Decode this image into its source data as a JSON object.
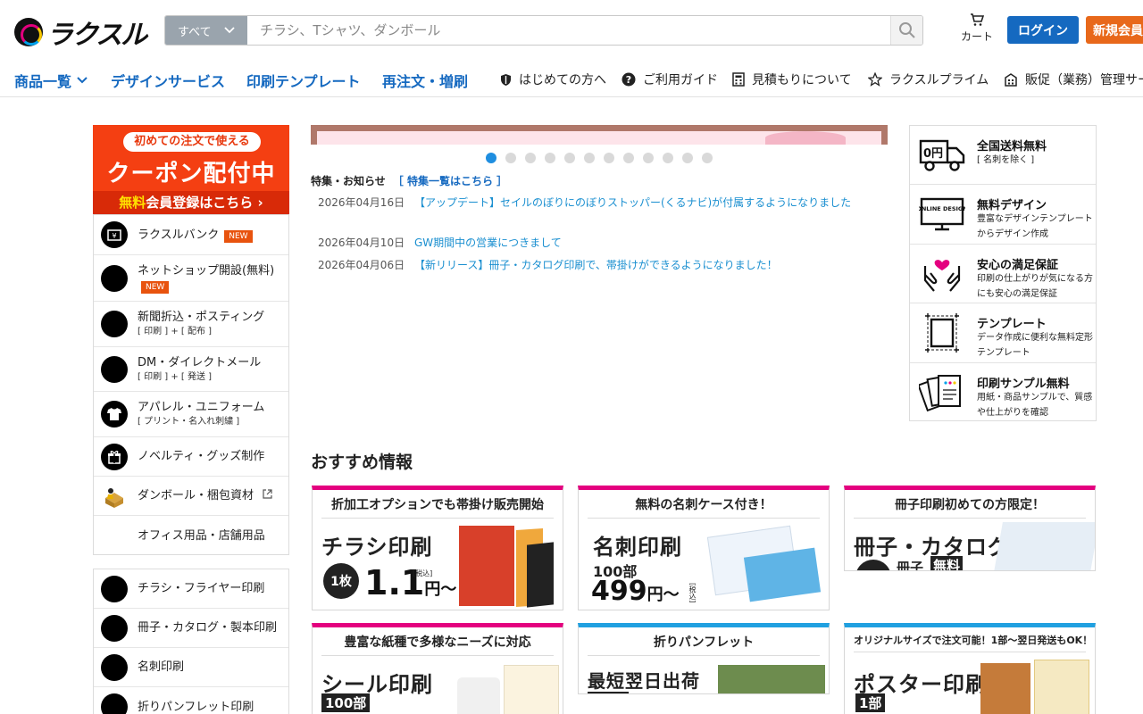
{
  "header": {
    "logo_text": "ラクスル",
    "search_category": "すべて",
    "search_placeholder": "チラシ、Tシャツ、ダンボール",
    "cart_label": "カート",
    "login_label": "ログイン",
    "register_label": "新規会員"
  },
  "nav": {
    "main": [
      "商品一覧",
      "デザインサービス",
      "印刷テンプレート",
      "再注文・増刷"
    ],
    "sub": [
      "はじめての方へ",
      "ご利用ガイド",
      "見積もりについて",
      "ラクスルプライム",
      "販促（業務）管理サー"
    ]
  },
  "coupon": {
    "top": "初めての注文で使える",
    "main": "クーポン配付中",
    "bottom_highlight": "無料",
    "bottom_rest": "会員登録はこちら ›"
  },
  "side_menu_1": [
    {
      "label": "ラクスルバンク",
      "badge": "NEW",
      "sub": ""
    },
    {
      "label": "ネットショップ開設(無料)",
      "badge": "NEW",
      "sub": ""
    },
    {
      "label": "新聞折込・ポスティング",
      "badge": "",
      "sub": "[ 印刷 ] + [ 配布 ]"
    },
    {
      "label": "DM・ダイレクトメール",
      "badge": "",
      "sub": "[ 印刷 ] + [ 発送 ]"
    },
    {
      "label": "アパレル・ユニフォーム",
      "badge": "",
      "sub": "[ プリント・名入れ刺繍 ]"
    },
    {
      "label": "ノベルティ・グッズ制作",
      "badge": "",
      "sub": ""
    },
    {
      "label": "ダンボール・梱包資材",
      "badge": "",
      "sub": ""
    },
    {
      "label": "オフィス用品・店舗用品",
      "badge": "",
      "sub": ""
    }
  ],
  "side_menu_2": [
    {
      "label": "チラシ・フライヤー印刷"
    },
    {
      "label": "冊子・カタログ・製本印刷"
    },
    {
      "label": "名刺印刷"
    },
    {
      "label": "折りパンフレット印刷"
    }
  ],
  "news": {
    "heading": "特集・お知らせ",
    "heading_link": "［ 特集一覧はこちら ］",
    "items": [
      {
        "date": "2026年04月16日",
        "text": "【アップデート】セイルのぼりにのぼりストッパー(くるナビ)が付属するようになりました"
      },
      {
        "date": "2026年04月10日",
        "text": "GW期間中の営業につきまして"
      },
      {
        "date": "2026年04月06日",
        "text": "【新リリース】冊子・カタログ印刷で、帯掛けができるようになりました！"
      }
    ]
  },
  "recommend": {
    "title": "おすすめ情報",
    "cards": [
      {
        "head": "折加工オプションでも帯掛け販売開始",
        "title": "チラシ印刷",
        "qty": "1枚",
        "price": "1.1",
        "unit": "円〜",
        "tax": "[税込]"
      },
      {
        "head": "無料の名刺ケース付き！",
        "title": "名刺印刷",
        "qty": "100部",
        "price": "499",
        "unit": "円〜",
        "tax": "[税込]"
      },
      {
        "head": "冊子印刷初めての方限定！",
        "title": "冊子・カタログ",
        "qty": "冊子",
        "price": "",
        "unit": "",
        "tax": "無料"
      },
      {
        "head": "豊富な紙種で多様なニーズに対応",
        "title": "シール印刷",
        "qty": "100部",
        "price": "",
        "unit": "",
        "tax": ""
      },
      {
        "head": "折りパンフレット",
        "title": "最短翌日出荷",
        "qty": "",
        "price": "",
        "unit": "",
        "tax": ""
      },
      {
        "head": "オリジナルサイズで注文可能！1部〜翌日発送もOK！",
        "title": "ポスター印刷",
        "qty": "1部",
        "price": "",
        "unit": "",
        "tax": ""
      }
    ]
  },
  "features": [
    {
      "title": "全国送料無料",
      "desc": "[ 名刺を除く ]"
    },
    {
      "title": "無料デザイン",
      "desc": "豊富なデザインテンプレートからデザイン作成"
    },
    {
      "title": "安心の満足保証",
      "desc": "印刷の仕上がりが気になる方にも安心の満足保証"
    },
    {
      "title": "テンプレート",
      "desc": "データ作成に便利な無料定形テンプレート"
    },
    {
      "title": "印刷サンプル無料",
      "desc": "用紙・商品サンプルで、質感や仕上がりを確認"
    }
  ],
  "feature_icon_text": {
    "truck": "0円",
    "online": "ONLINE DESIGN"
  },
  "slider": {
    "count": 12,
    "active": 1
  },
  "colors": {
    "brand_blue": "#1569c0",
    "register_orange": "#e8681a",
    "coupon_red": "#f43f12",
    "link_blue": "#1a8fd0",
    "card_pink": "#e4007f",
    "card_blue": "#20a0e0"
  }
}
